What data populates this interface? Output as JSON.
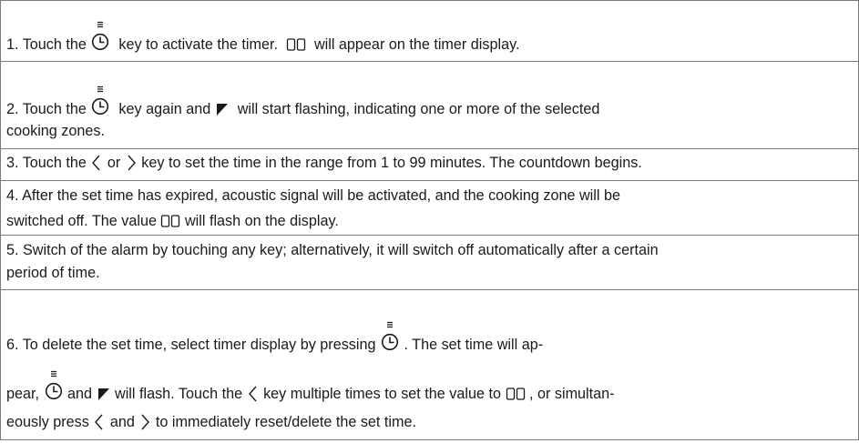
{
  "icons": {
    "timer_key": "timer-key-icon",
    "display_00": "display-00-icon",
    "cooking_zone_indicator": "cooking-zone-indicator-icon",
    "minus_key": "chevron-left-icon",
    "plus_key": "chevron-right-icon"
  },
  "colors": {
    "text": "#1a1a1a",
    "rule": "#7a7a7a"
  },
  "steps": [
    {
      "a": "1. Touch the ",
      "b": "  key to activate the timer.  ",
      "c": "  will appear on the timer display."
    },
    {
      "a": "2. Touch the ",
      "b": "  key again and ",
      "c": "  will start flashing, indicating one or more of the selected",
      "d": "cooking zones."
    },
    {
      "a": "3. Touch the ",
      "b": " or ",
      "c": " key to set the time in the range from 1 to 99 minutes. The countdown begins."
    },
    {
      "a": "4. After the set time has expired, acoustic signal will be activated, and the cooking zone will be",
      "b": "switched off. The value ",
      "c": " will flash on the display."
    },
    {
      "a": "5. Switch of the alarm by touching any key; alternatively, it will switch off automatically after a certain",
      "b": "period of time."
    },
    {
      "a": "6. To delete the set time, select timer display by pressing ",
      "b": " . The set time will ap-",
      "c": "pear, ",
      "d": " and ",
      "e": " will flash. Touch the ",
      "f": " key multiple times to set the value to ",
      "g": " , or simultan-",
      "h": "eously press ",
      "i": " and ",
      "j": " to immediately reset/delete the set time."
    }
  ]
}
